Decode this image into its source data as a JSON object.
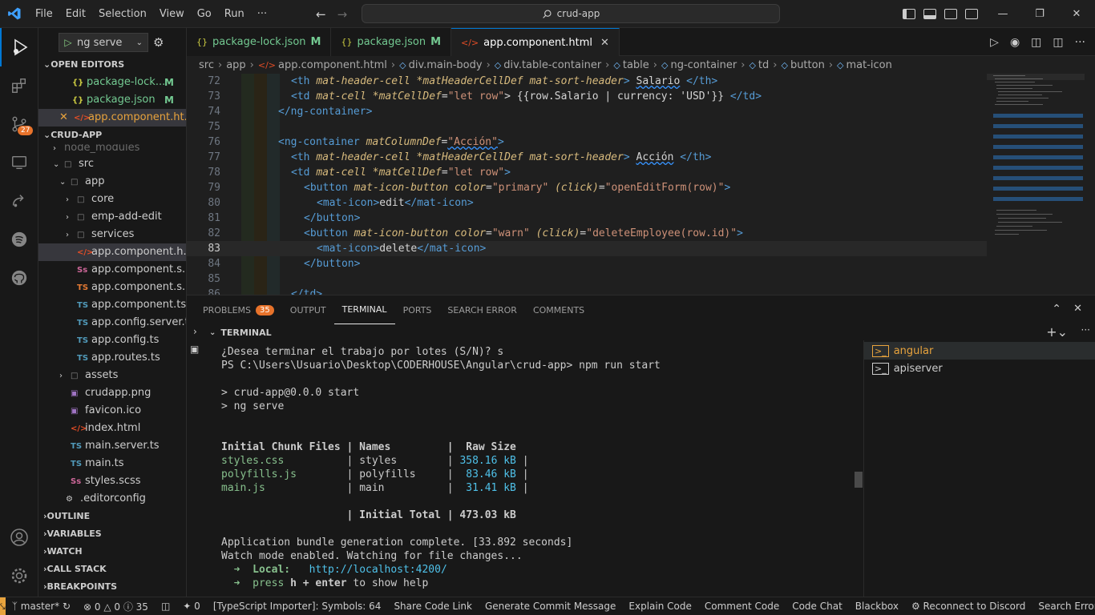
{
  "titlebar": {
    "menu": [
      "File",
      "Edit",
      "Selection",
      "View",
      "Go",
      "Run",
      "···"
    ],
    "search_text": "crud-app"
  },
  "activity_bar": {
    "source_control_badge": "27"
  },
  "run_config": {
    "label": "ng serve"
  },
  "sidebar": {
    "open_editors_header": "OPEN EDITORS",
    "open_editors": [
      {
        "name": "package-lock...",
        "status": "M",
        "icon": "{}"
      },
      {
        "name": "package.json",
        "status": "M",
        "icon": "{}"
      },
      {
        "name": "app.component.ht...",
        "status": "",
        "icon": "</>"
      }
    ],
    "project_header": "CRUD-APP",
    "tree": [
      {
        "name": "node_modules",
        "depth": 1,
        "type": "folder"
      },
      {
        "name": "src",
        "depth": 1,
        "type": "folder-open"
      },
      {
        "name": "app",
        "depth": 2,
        "type": "folder-open"
      },
      {
        "name": "core",
        "depth": 3,
        "type": "folder"
      },
      {
        "name": "emp-add-edit",
        "depth": 3,
        "type": "folder"
      },
      {
        "name": "services",
        "depth": 3,
        "type": "folder"
      },
      {
        "name": "app.component.h...",
        "depth": 3,
        "type": "html"
      },
      {
        "name": "app.component.s...",
        "depth": 3,
        "type": "scss"
      },
      {
        "name": "app.component.s...",
        "depth": 3,
        "type": "ts"
      },
      {
        "name": "app.component.ts",
        "depth": 3,
        "type": "ts"
      },
      {
        "name": "app.config.server.ts",
        "depth": 3,
        "type": "ts"
      },
      {
        "name": "app.config.ts",
        "depth": 3,
        "type": "ts"
      },
      {
        "name": "app.routes.ts",
        "depth": 3,
        "type": "ts"
      },
      {
        "name": "assets",
        "depth": 2,
        "type": "folder"
      },
      {
        "name": "crudapp.png",
        "depth": 2,
        "type": "img"
      },
      {
        "name": "favicon.ico",
        "depth": 2,
        "type": "img"
      },
      {
        "name": "index.html",
        "depth": 2,
        "type": "html"
      },
      {
        "name": "main.server.ts",
        "depth": 2,
        "type": "ts"
      },
      {
        "name": "main.ts",
        "depth": 2,
        "type": "ts"
      },
      {
        "name": "styles.scss",
        "depth": 2,
        "type": "scss"
      },
      {
        "name": ".editorconfig",
        "depth": 1,
        "type": "config"
      }
    ],
    "sections": [
      "OUTLINE",
      "VARIABLES",
      "WATCH",
      "CALL STACK",
      "BREAKPOINTS"
    ]
  },
  "tabs": [
    {
      "label": "package-lock.json",
      "status": "M",
      "icon": "{}"
    },
    {
      "label": "package.json",
      "status": "M",
      "icon": "{}"
    },
    {
      "label": "app.component.html",
      "status": "",
      "icon": "</>"
    }
  ],
  "breadcrumb": [
    "src",
    "app",
    "app.component.html",
    "div.main-body",
    "div.table-container",
    "table",
    "ng-container",
    "td",
    "button",
    "mat-icon"
  ],
  "code_lines": [
    {
      "n": "72"
    },
    {
      "n": "73"
    },
    {
      "n": "74"
    },
    {
      "n": "75"
    },
    {
      "n": "76"
    },
    {
      "n": "77"
    },
    {
      "n": "78"
    },
    {
      "n": "79"
    },
    {
      "n": "80"
    },
    {
      "n": "81"
    },
    {
      "n": "82"
    },
    {
      "n": "83"
    },
    {
      "n": "84"
    },
    {
      "n": "85"
    },
    {
      "n": "86"
    }
  ],
  "code": {
    "l72": [
      "<th ",
      "mat-header-cell ",
      "*matHeaderCellDef ",
      "mat-sort-header",
      "> ",
      "Salario",
      " </th>"
    ],
    "l73": [
      "<td ",
      "mat-cell ",
      "*matCellDef",
      "=",
      "\"let row\"",
      "> {{row.Salario | currency: 'USD'}} ",
      "</td>"
    ],
    "l74": [
      "</ng-container>"
    ],
    "l76": [
      "<ng-container ",
      "matColumnDef",
      "=",
      "\"Acción\"",
      ">"
    ],
    "l77": [
      "<th ",
      "mat-header-cell ",
      "*matHeaderCellDef ",
      "mat-sort-header",
      "> ",
      "Acción",
      " </th>"
    ],
    "l78": [
      "<td ",
      "mat-cell ",
      "*matCellDef",
      "=",
      "\"let row\"",
      ">"
    ],
    "l79": [
      "<button ",
      "mat-icon-button ",
      "color",
      "=",
      "\"primary\" ",
      "(click)",
      "=",
      "\"openEditForm(row)\"",
      ">"
    ],
    "l80": [
      "<mat-icon>",
      "edit",
      "</mat-icon>"
    ],
    "l81": [
      "</button>"
    ],
    "l82": [
      "<button ",
      "mat-icon-button ",
      "color",
      "=",
      "\"warn\" ",
      "(click)",
      "=",
      "\"deleteEmployee(row.id)\"",
      ">"
    ],
    "l83": [
      "<mat-icon>",
      "delete",
      "</mat-icon>"
    ],
    "l84": [
      "</button>"
    ],
    "l86": [
      "</td>"
    ]
  },
  "panel": {
    "tabs": [
      "PROBLEMS",
      "OUTPUT",
      "TERMINAL",
      "PORTS",
      "SEARCH ERROR",
      "COMMENTS"
    ],
    "problems_count": "35",
    "terminal_header": "TERMINAL",
    "terminal_lines": {
      "t1": "¿Desea terminar el trabajo por lotes (S/N)? s",
      "t2": "PS C:\\Users\\Usuario\\Desktop\\CODERHOUSE\\Angular\\crud-app> npm run start",
      "t3": "",
      "t4": "> crud-app@0.0.0 start",
      "t5": "> ng serve",
      "t6": "",
      "t7": "",
      "t8h": "Initial Chunk Files | Names         |  Raw Size",
      "f1_name": "styles.css",
      "f1_rest": "          | styles        | ",
      "f1_size": "358.16 kB",
      "f1_end": " |",
      "f2_name": "polyfills.js",
      "f2_rest": "        | polyfills     |  ",
      "f2_size": "83.46 kB",
      "f2_end": " |",
      "f3_name": "main.js",
      "f3_rest": "             | main          |  ",
      "f3_size": "31.41 kB",
      "f3_end": " |",
      "t12": "",
      "total": "                    | Initial Total | 473.03 kB",
      "t14": "",
      "gen": "Application bundle generation complete. [33.892 seconds]",
      "watch": "Watch mode enabled. Watching for file changes...",
      "local_label": "  ➜  Local:   ",
      "local_url": "http://localhost:4200/",
      "help_pre": "  ➜  press ",
      "help_key": "h + enter",
      "help_post": " to show help"
    },
    "terminal_instances": [
      "angular",
      "apiserver"
    ]
  },
  "statusbar": {
    "branch": "master*",
    "errors": "0",
    "warnings": "0",
    "infos": "35",
    "ports": "0",
    "items": [
      "[TypeScript Importer]: Symbols: 64",
      "Share Code Link",
      "Generate Commit Message",
      "Explain Code",
      "Comment Code",
      "Code Chat",
      "Blackbox",
      "Reconnect to Discord",
      "Search Error"
    ]
  }
}
